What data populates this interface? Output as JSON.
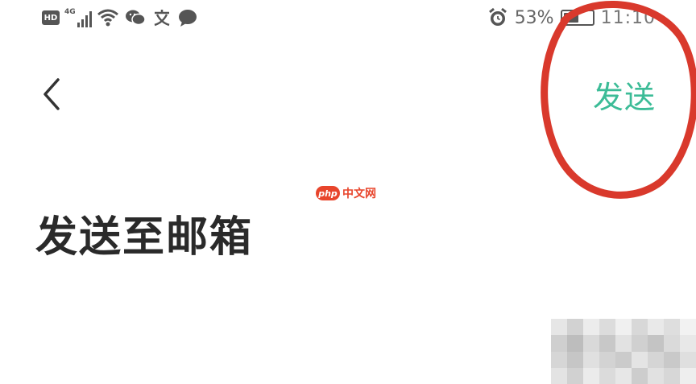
{
  "status_bar": {
    "hd_label": "HD",
    "network_type": "4G",
    "icons": [
      "hd-icon",
      "signal-icon",
      "wifi-icon",
      "wechat-icon",
      "translate-icon",
      "chat-bubble-icon",
      "alarm-icon",
      "battery-icon"
    ],
    "battery_percent": "53%",
    "battery_level": 0.53,
    "time": "11:10"
  },
  "nav": {
    "back_icon": "chevron-left-icon",
    "send_label": "发送",
    "send_color": "#3cbc97"
  },
  "page": {
    "title": "发送至邮箱"
  },
  "watermark": {
    "logo_text": "php",
    "site_text": "中文网",
    "color": "#e8452c"
  },
  "annotation": {
    "highlight_color": "#d9392c"
  }
}
